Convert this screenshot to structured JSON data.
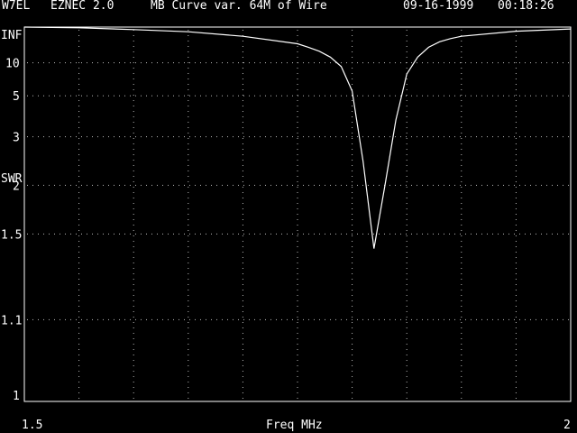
{
  "header": {
    "callsign": "W7EL",
    "program": "EZNEC 2.0",
    "title": "MB Curve var. 64M of Wire",
    "date": "09-16-1999",
    "time": "00:18:26"
  },
  "colors": {
    "background": "#000000",
    "foreground": "#ffffff",
    "grid_dots": "#bbbbbb"
  },
  "chart_data": {
    "type": "line",
    "title": "MB Curve var. 64M of Wire",
    "xlabel": "Freq MHz",
    "ylabel": "SWR",
    "xlim": [
      1.5,
      2.0
    ],
    "y_scale": "log-swr",
    "y_ticks": [
      {
        "value": 999,
        "label": "INF"
      },
      {
        "value": 10,
        "label": "10"
      },
      {
        "value": 5,
        "label": "5"
      },
      {
        "value": 3,
        "label": "3"
      },
      {
        "value": 2,
        "label": "2"
      },
      {
        "value": 1.5,
        "label": "1.5"
      },
      {
        "value": 1.1,
        "label": "1.1"
      },
      {
        "value": 1,
        "label": "1"
      }
    ],
    "x_tick_labels": [
      {
        "value": 1.5,
        "label": "1.5"
      },
      {
        "value": 2.0,
        "label": "2"
      }
    ],
    "grid": true,
    "series": [
      {
        "x": [
          1.5,
          1.55,
          1.6,
          1.65,
          1.7,
          1.75,
          1.76,
          1.77,
          1.78,
          1.79,
          1.8,
          1.81,
          1.82,
          1.83,
          1.84,
          1.85,
          1.86,
          1.87,
          1.88,
          1.89,
          1.9,
          1.95,
          2.0
        ],
        "y": [
          999,
          500,
          150,
          80,
          40,
          22,
          18,
          15,
          12,
          9,
          5.4,
          2.4,
          1.4,
          2.0,
          3.6,
          7.5,
          12,
          18,
          25,
          32,
          40,
          90,
          200
        ]
      }
    ]
  }
}
